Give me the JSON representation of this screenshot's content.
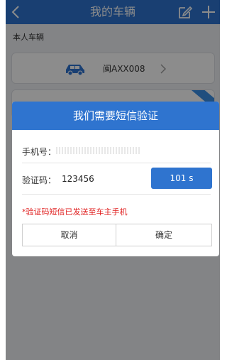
{
  "header": {
    "title": "我的车辆",
    "back_icon": "chevron-left-icon",
    "edit_icon": "edit-icon",
    "add_icon": "plus-icon",
    "color": "#2f74cf"
  },
  "section_label": "本人车辆",
  "vehicle": {
    "plate": "闽AXX008",
    "car_icon": "car-icon",
    "chevron_icon": "chevron-right-icon"
  },
  "dialog": {
    "title": "我们需要短信验证",
    "phone_label": "手机号：",
    "code_label": "验证码：",
    "code_value": "123456",
    "countdown": "101 s",
    "notice": "*验证码短信已发送至车主手机",
    "cancel": "取消",
    "confirm": "确定",
    "accent": "#2f74cf",
    "notice_color": "#e02020"
  }
}
